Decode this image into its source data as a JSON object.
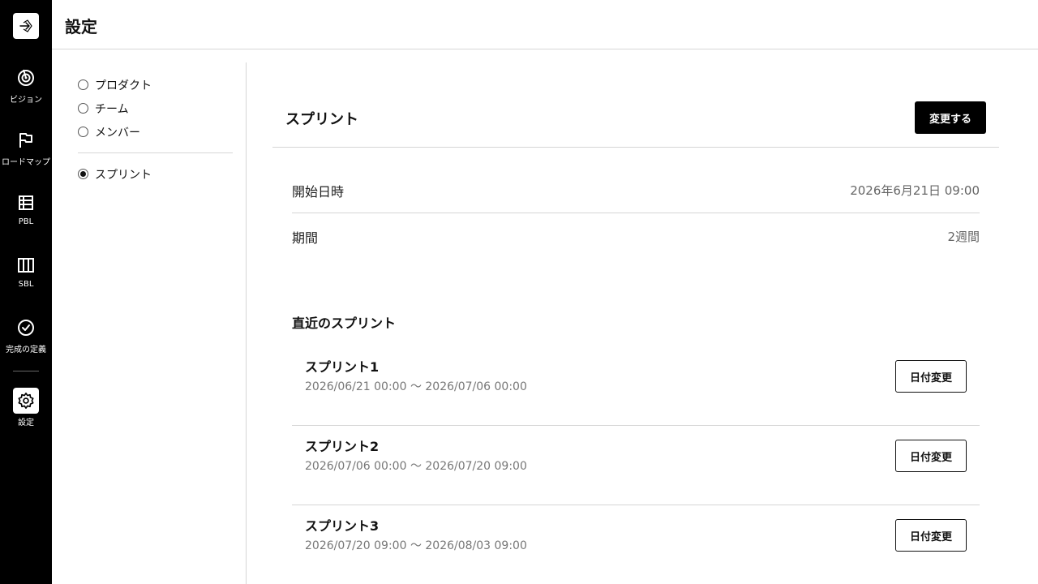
{
  "app": {
    "logo_icon": "logo-arrow-icon"
  },
  "nav": {
    "items": [
      {
        "label": "ビジョン",
        "icon": "target-icon"
      },
      {
        "label": "ロードマップ",
        "icon": "flag-icon"
      },
      {
        "label": "PBL",
        "icon": "list-icon"
      },
      {
        "label": "SBL",
        "icon": "columns-icon"
      },
      {
        "label": "完成の定義",
        "icon": "check-circle-icon"
      },
      {
        "label": "設定",
        "icon": "gear-icon",
        "active": true
      }
    ]
  },
  "header": {
    "title": "設定"
  },
  "menu": {
    "items": [
      {
        "label": "プロダクト",
        "checked": false
      },
      {
        "label": "チーム",
        "checked": false
      },
      {
        "label": "メンバー",
        "checked": false
      },
      {
        "label": "スプリント",
        "checked": true
      }
    ]
  },
  "sprint_settings": {
    "title": "スプリント",
    "change_button": "変更する",
    "start_label": "開始日時",
    "start_value": "2026年6月21日 09:00",
    "duration_label": "期間",
    "duration_value": "2週間"
  },
  "recent": {
    "title": "直近のスプリント",
    "sprints": [
      {
        "name": "スプリント1",
        "range": "2026/06/21 00:00 〜 2026/07/06 00:00",
        "button": "日付変更"
      },
      {
        "name": "スプリント2",
        "range": "2026/07/06 00:00 〜 2026/07/20 09:00",
        "button": "日付変更"
      },
      {
        "name": "スプリント3",
        "range": "2026/07/20 09:00 〜 2026/08/03 09:00",
        "button": "日付変更"
      }
    ]
  },
  "colors": {
    "rail": "#000000",
    "primary_button": "#000000",
    "divider": "#d6d6d6",
    "muted_text": "#666666"
  }
}
